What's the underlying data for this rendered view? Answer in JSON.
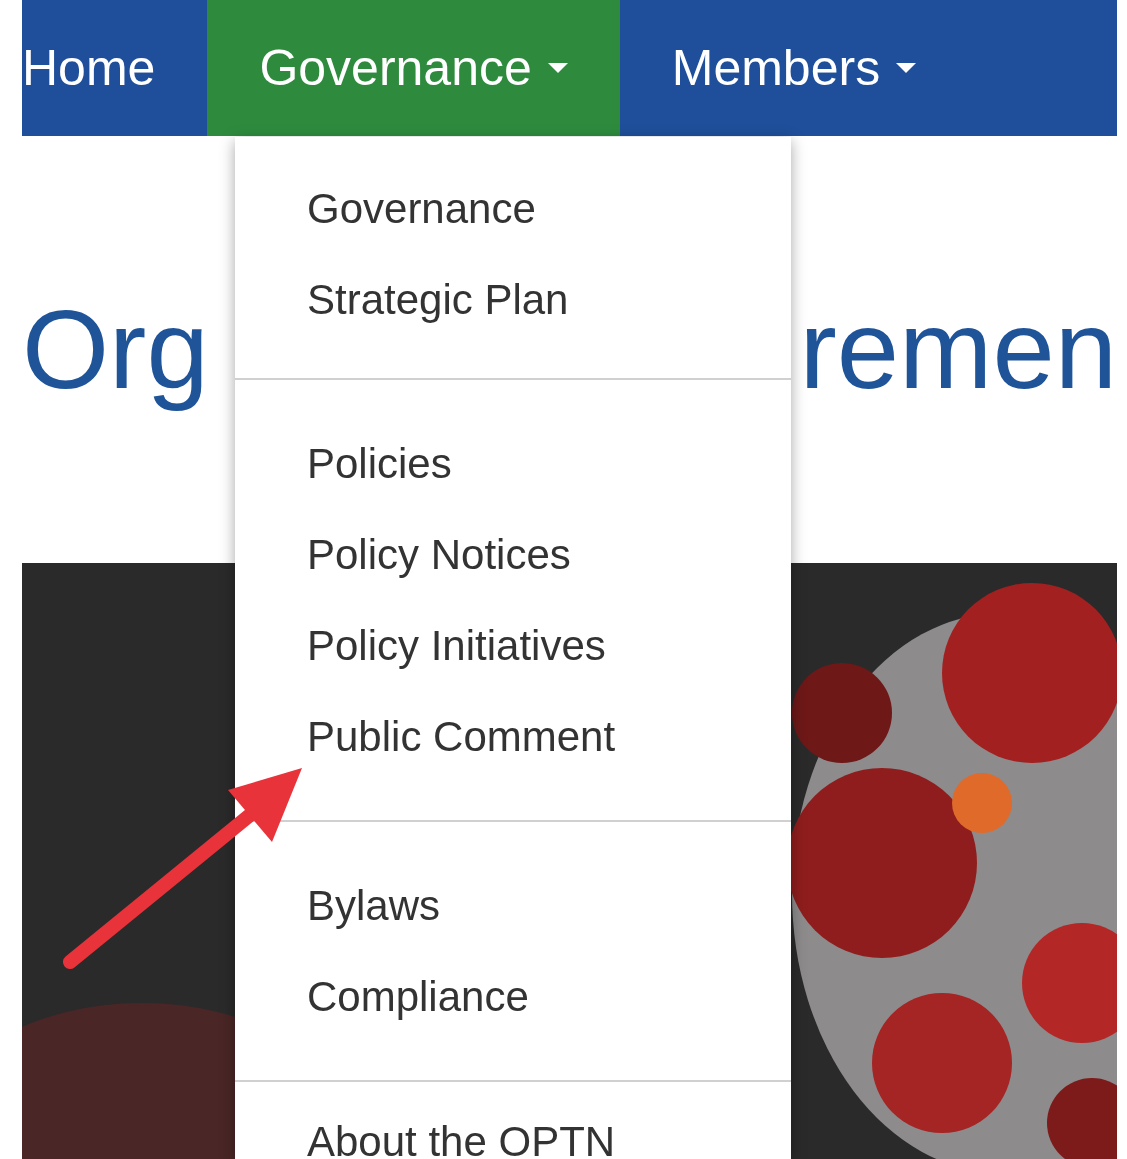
{
  "nav": {
    "items": [
      {
        "label": "Home",
        "selected": false,
        "has_caret": false
      },
      {
        "label": "Governance",
        "selected": true,
        "has_caret": true
      },
      {
        "label": "Members",
        "selected": false,
        "has_caret": true
      }
    ]
  },
  "heading": {
    "visible_parts": [
      "Org",
      "remen"
    ]
  },
  "dropdown": {
    "groups": [
      {
        "items": [
          "Governance",
          "Strategic Plan"
        ]
      },
      {
        "items": [
          "Policies",
          "Policy Notices",
          "Policy Initiatives",
          "Public Comment"
        ]
      },
      {
        "items": [
          "Bylaws",
          "Compliance"
        ]
      },
      {
        "items": [
          "About the OPTN"
        ]
      }
    ]
  }
}
